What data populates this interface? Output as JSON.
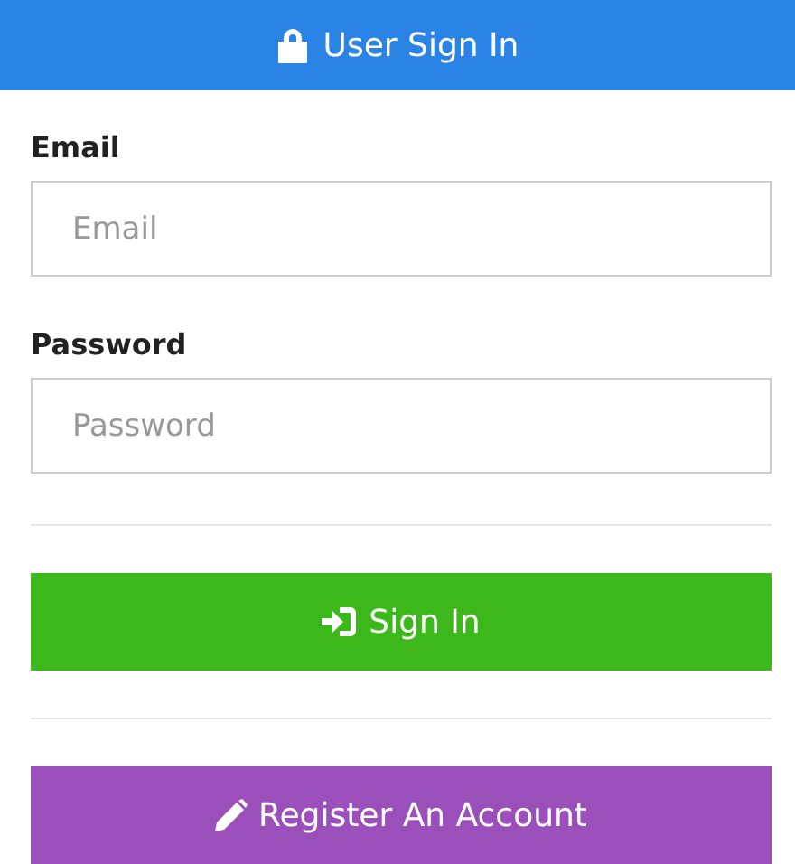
{
  "header": {
    "title": "User Sign In"
  },
  "fields": [
    {
      "label": "Email",
      "placeholder": "Email"
    },
    {
      "label": "Password",
      "placeholder": "Password"
    }
  ],
  "buttons": [
    {
      "label": "Sign In",
      "kind": "signin"
    },
    {
      "label": "Register An Account",
      "kind": "register"
    }
  ]
}
